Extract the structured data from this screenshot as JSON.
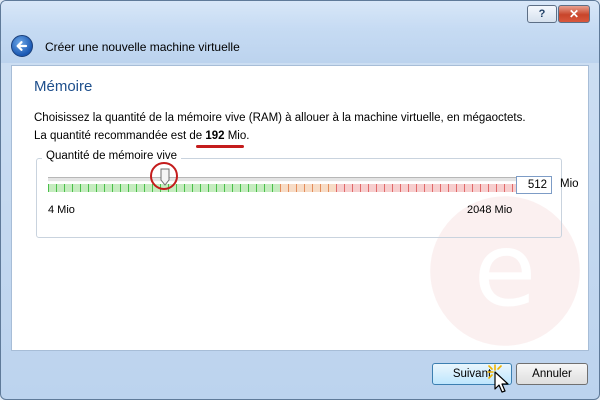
{
  "window": {
    "title": "Créer une nouvelle machine virtuelle",
    "help_glyph": "?",
    "close_glyph": "✕"
  },
  "page": {
    "heading": "Mémoire",
    "description": "Choisissez la quantité de la mémoire vive (RAM) à allouer à la machine virtuelle, en mégaoctets.",
    "recommended_prefix": "La quantité recommandée est de ",
    "recommended_value": "192",
    "recommended_suffix": " Mio."
  },
  "memory": {
    "group_label": "Quantité de mémoire vive",
    "min_label": "4 Mio",
    "max_label": "2048 Mio",
    "value": "512",
    "unit": "Mio",
    "slider_level": 0.25
  },
  "buttons": {
    "next_label": "Suivant",
    "cancel_label": "Annuler"
  },
  "colors": {
    "accent": "#1e4f8c",
    "annotation": "#c41c1c",
    "zone_ok": "#4bbf4b",
    "zone_warn": "#e38d5b",
    "zone_bad": "#e06a6a"
  },
  "icons": {
    "back": "back-arrow-icon",
    "thumb": "slider-thumb-icon",
    "cursor": "mouse-cursor-icon"
  }
}
